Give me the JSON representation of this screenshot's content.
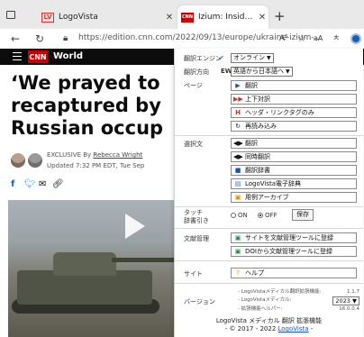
{
  "browser": {
    "tabs": [
      {
        "title": "LogoVista",
        "favicon_text": "LV"
      },
      {
        "title": "Izium: Inside city recaptured by Ukraine",
        "favicon_text": "CNN"
      }
    ],
    "url": "https://edition.cnn.com/2022/09/13/europe/ukraine-izium-...",
    "toolbar_glyphs": {
      "read_aloud": "A⁵",
      "favorites": "☆",
      "translate": "aA",
      "reader": "ㅊ"
    }
  },
  "article": {
    "section": "World",
    "headline_lines": [
      "‘We prayed to",
      "recaptured by",
      "Russian occup"
    ],
    "byline_prefix": "EXCLUSIVE By ",
    "author": "Rebecca Wright",
    "updated": "Updated 7:32 PM EDT, Tue Sep"
  },
  "popup": {
    "engine": {
      "label": "翻訳エンジン",
      "value": "オンライン"
    },
    "direction": {
      "label": "翻訳方向",
      "value": "英語から日本語へ",
      "ew": "EW"
    },
    "page": {
      "label": "ページ",
      "buttons": [
        "翻訳",
        "上下対訳",
        "ヘッダ・リンクタグのみ",
        "再読み込み"
      ]
    },
    "selection": {
      "label": "選択文",
      "buttons": [
        "翻訳",
        "同時翻訳",
        "翻訳辞書",
        "LogoVista電子辞典",
        "用例アーカイブ"
      ]
    },
    "touch": {
      "label_line1": "タッチ",
      "label_line2": "辞書引き",
      "on": "ON",
      "off": "OFF",
      "save": "保存",
      "selected": "OFF"
    },
    "documents": {
      "label": "文献管理",
      "buttons": [
        "サイトを文献管理ツールに登録",
        "DOIから文献管理ツールに登録"
      ]
    },
    "site": {
      "label": "サイト",
      "button": "ヘルプ"
    },
    "version": {
      "label": "バージョン",
      "rows": [
        {
          "name": "- LogoVistaメディカル翻訳拡張機能:",
          "value": "1.1.7"
        },
        {
          "name": "- LogoVistaメディカル:",
          "value": "2023"
        },
        {
          "name": "- 拡張機能ヘルパー:",
          "value": "16.0.0.4"
        }
      ]
    },
    "footer": {
      "line1": "LogoVista メディカル 翻訳 拡張機能",
      "line2_prefix": "- © 2017 - 2022 ",
      "link": "LogoVista",
      "line2_suffix": " -"
    }
  }
}
